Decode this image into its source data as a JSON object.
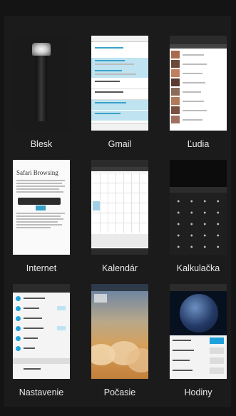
{
  "apps": [
    {
      "id": "blesk",
      "label": "Blesk"
    },
    {
      "id": "gmail",
      "label": "Gmail"
    },
    {
      "id": "ludia",
      "label": "Ľudia"
    },
    {
      "id": "internet",
      "label": "Internet"
    },
    {
      "id": "kalendar",
      "label": "Kalendár"
    },
    {
      "id": "kalkulacka",
      "label": "Kalkulačka"
    },
    {
      "id": "nastavenie",
      "label": "Nastavenie"
    },
    {
      "id": "pocasie",
      "label": "Počasie"
    },
    {
      "id": "hodiny",
      "label": "Hodiny"
    }
  ],
  "internet_page_title": "Safari Browsing",
  "colors": {
    "background": "#141414",
    "gmail_highlight": "#bfe3f0",
    "calendar_accent": "#9fd0e6",
    "settings_blue": "#1fa0dd"
  }
}
